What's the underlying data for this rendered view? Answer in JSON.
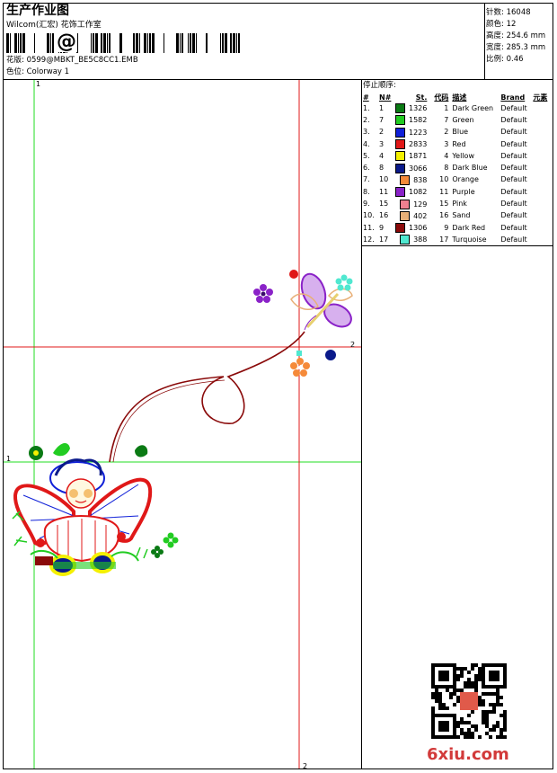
{
  "header": {
    "title": "生产作业图",
    "company": "Wilcom(汇宏) 花饰工作室",
    "barcode_symbol": "@",
    "design_label": "花版: 0599@MBKT_BE5C8CC1.EMB",
    "colorway_label": "色位: Colorway 1"
  },
  "stats": [
    {
      "label": "针数",
      "value": "16048"
    },
    {
      "label": "颜色",
      "value": "12"
    },
    {
      "label": "高度",
      "value": "254.6 mm"
    },
    {
      "label": "宽度",
      "value": "285.3 mm"
    },
    {
      "label": "比例",
      "value": "0.46"
    }
  ],
  "stop_sequence": {
    "title": "停止顺序:",
    "headers": [
      "#",
      "N#",
      "St.",
      "代码",
      "描述",
      "Brand",
      "元素"
    ],
    "rows": [
      {
        "idx": "1.",
        "n": "1",
        "color": "#0a7a14",
        "st": "1326",
        "code": "1",
        "desc": "Dark Green",
        "brand": "Default"
      },
      {
        "idx": "2.",
        "n": "7",
        "color": "#22cc22",
        "st": "1582",
        "code": "7",
        "desc": "Green",
        "brand": "Default"
      },
      {
        "idx": "3.",
        "n": "2",
        "color": "#1020d8",
        "st": "1223",
        "code": "2",
        "desc": "Blue",
        "brand": "Default"
      },
      {
        "idx": "4.",
        "n": "3",
        "color": "#e01818",
        "st": "2833",
        "code": "3",
        "desc": "Red",
        "brand": "Default"
      },
      {
        "idx": "5.",
        "n": "4",
        "color": "#f4f000",
        "st": "1871",
        "code": "4",
        "desc": "Yellow",
        "brand": "Default"
      },
      {
        "idx": "6.",
        "n": "8",
        "color": "#0a1a8a",
        "st": "3066",
        "code": "8",
        "desc": "Dark Blue",
        "brand": "Default"
      },
      {
        "idx": "7.",
        "n": "10",
        "color": "#f58a3a",
        "st": "838",
        "code": "10",
        "desc": "Orange",
        "brand": "Default"
      },
      {
        "idx": "8.",
        "n": "11",
        "color": "#8a22c8",
        "st": "1082",
        "code": "11",
        "desc": "Purple",
        "brand": "Default"
      },
      {
        "idx": "9.",
        "n": "15",
        "color": "#f08090",
        "st": "129",
        "code": "15",
        "desc": "Pink",
        "brand": "Default"
      },
      {
        "idx": "10.",
        "n": "16",
        "color": "#e8b078",
        "st": "402",
        "code": "16",
        "desc": "Sand",
        "brand": "Default"
      },
      {
        "idx": "11.",
        "n": "9",
        "color": "#8a0a0a",
        "st": "1306",
        "code": "9",
        "desc": "Dark Red",
        "brand": "Default"
      },
      {
        "idx": "12.",
        "n": "17",
        "color": "#50e8d0",
        "st": "388",
        "code": "17",
        "desc": "Turquoise",
        "brand": "Default"
      }
    ]
  },
  "guides": {
    "green_top_label": "1",
    "green_left_label": "1",
    "red_right_label": "2",
    "red_bottom_label": "2"
  },
  "watermark": {
    "site": "6xiu.com"
  }
}
